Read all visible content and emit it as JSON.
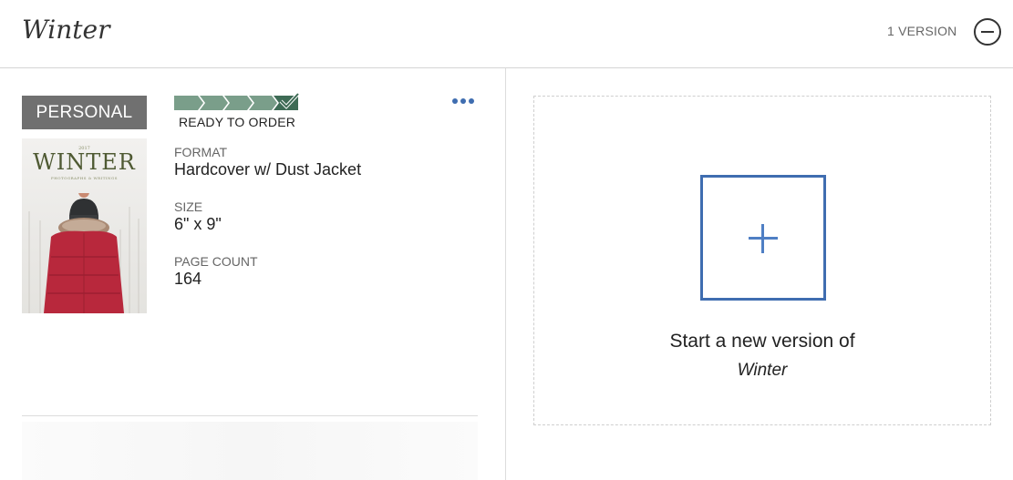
{
  "header": {
    "title": "Winter",
    "version_count": "1 VERSION"
  },
  "version": {
    "badge": "PERSONAL",
    "cover": {
      "year": "2017",
      "title": "WINTER",
      "subtitle": "PHOTOGRAPHS & WRITINGS"
    },
    "progress": {
      "steps_total": 5,
      "steps_complete": 5,
      "status": "READY TO ORDER",
      "step_color": "#7a9e8a",
      "final_step_color": "#3e6b55"
    },
    "specs": [
      {
        "label": "FORMAT",
        "value": "Hardcover w/ Dust Jacket"
      },
      {
        "label": "SIZE",
        "value": "6\" x 9\""
      },
      {
        "label": "PAGE COUNT",
        "value": "164"
      }
    ]
  },
  "new_version": {
    "line1": "Start a new version of",
    "book_title": "Winter"
  },
  "colors": {
    "accent": "#3f6db0",
    "badge_bg": "#707070"
  }
}
